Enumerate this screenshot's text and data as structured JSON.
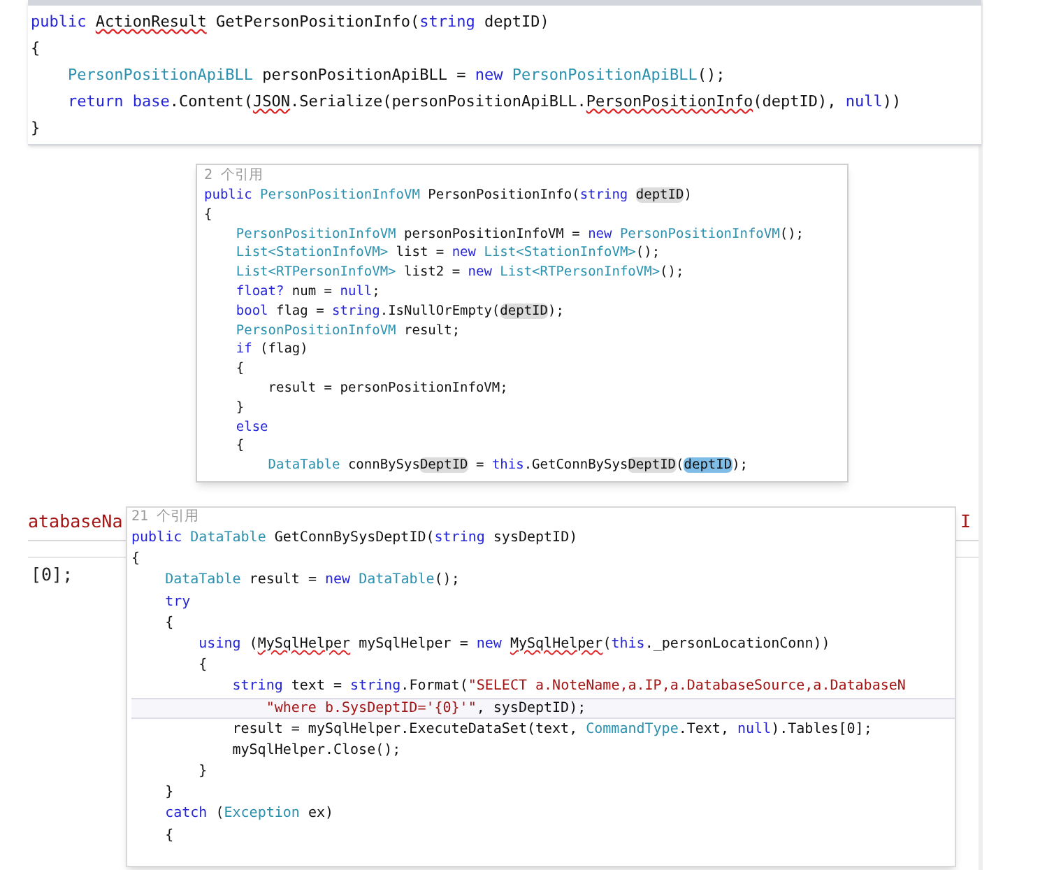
{
  "background": {
    "left_text": "atabaseNa",
    "right_text": "I",
    "second_line": "[0];"
  },
  "panels": [
    {
      "lines": [
        {
          "kind": "code",
          "tokens": [
            {
              "kind": "keyword",
              "text": "public "
            },
            {
              "kind": "error",
              "text": "ActionResult"
            },
            {
              "kind": "plain",
              "text": " GetPersonPositionInfo("
            },
            {
              "kind": "keyword",
              "text": "string"
            },
            {
              "kind": "plain",
              "text": " deptID)"
            }
          ]
        },
        {
          "kind": "code",
          "tokens": [
            {
              "kind": "plain",
              "text": "{"
            }
          ]
        },
        {
          "kind": "code",
          "tokens": [
            {
              "kind": "type",
              "text": "    PersonPositionApiBLL"
            },
            {
              "kind": "plain",
              "text": " personPositionApiBLL = "
            },
            {
              "kind": "keyword",
              "text": "new "
            },
            {
              "kind": "type",
              "text": "PersonPositionApiBLL"
            },
            {
              "kind": "plain",
              "text": "();"
            }
          ]
        },
        {
          "kind": "code",
          "tokens": [
            {
              "kind": "keyword",
              "text": "    return base"
            },
            {
              "kind": "plain",
              "text": ".Content("
            },
            {
              "kind": "error",
              "text": "JSON"
            },
            {
              "kind": "plain",
              "text": ".Serialize(personPositionApiBLL."
            },
            {
              "kind": "error",
              "text": "PersonPositionInfo"
            },
            {
              "kind": "plain",
              "text": "(deptID), "
            },
            {
              "kind": "keyword",
              "text": "null"
            },
            {
              "kind": "plain",
              "text": "))"
            }
          ]
        },
        {
          "kind": "code",
          "tokens": [
            {
              "kind": "plain",
              "text": "}"
            }
          ]
        }
      ]
    },
    {
      "lines": [
        {
          "kind": "lens",
          "text": "2 个引用"
        },
        {
          "kind": "code",
          "tokens": [
            {
              "kind": "keyword",
              "text": "public "
            },
            {
              "kind": "type",
              "text": "PersonPositionInfoVM"
            },
            {
              "kind": "plain",
              "text": " PersonPositionInfo("
            },
            {
              "kind": "keyword",
              "text": "string "
            },
            {
              "kind": "highlight",
              "text": "deptID"
            },
            {
              "kind": "plain",
              "text": ")"
            }
          ]
        },
        {
          "kind": "code",
          "tokens": [
            {
              "kind": "plain",
              "text": "{"
            }
          ]
        },
        {
          "kind": "code",
          "tokens": [
            {
              "kind": "type",
              "text": "    PersonPositionInfoVM"
            },
            {
              "kind": "plain",
              "text": " personPositionInfoVM = "
            },
            {
              "kind": "keyword",
              "text": "new "
            },
            {
              "kind": "type",
              "text": "PersonPositionInfoVM"
            },
            {
              "kind": "plain",
              "text": "();"
            }
          ]
        },
        {
          "kind": "code",
          "tokens": [
            {
              "kind": "type",
              "text": "    List<StationInfoVM>"
            },
            {
              "kind": "plain",
              "text": " list = "
            },
            {
              "kind": "keyword",
              "text": "new "
            },
            {
              "kind": "type",
              "text": "List<StationInfoVM>"
            },
            {
              "kind": "plain",
              "text": "();"
            }
          ]
        },
        {
          "kind": "code",
          "tokens": [
            {
              "kind": "type",
              "text": "    List<RTPersonInfoVM>"
            },
            {
              "kind": "plain",
              "text": " list2 = "
            },
            {
              "kind": "keyword",
              "text": "new "
            },
            {
              "kind": "type",
              "text": "List<RTPersonInfoVM>"
            },
            {
              "kind": "plain",
              "text": "();"
            }
          ]
        },
        {
          "kind": "code",
          "tokens": [
            {
              "kind": "keyword",
              "text": "    float?"
            },
            {
              "kind": "plain",
              "text": " num = "
            },
            {
              "kind": "keyword",
              "text": "null"
            },
            {
              "kind": "plain",
              "text": ";"
            }
          ]
        },
        {
          "kind": "code",
          "tokens": [
            {
              "kind": "keyword",
              "text": "    bool"
            },
            {
              "kind": "plain",
              "text": " flag = "
            },
            {
              "kind": "keyword",
              "text": "string"
            },
            {
              "kind": "plain",
              "text": ".IsNullOrEmpty("
            },
            {
              "kind": "highlight",
              "text": "deptID"
            },
            {
              "kind": "plain",
              "text": ");"
            }
          ]
        },
        {
          "kind": "code",
          "tokens": [
            {
              "kind": "type",
              "text": "    PersonPositionInfoVM"
            },
            {
              "kind": "plain",
              "text": " result;"
            }
          ]
        },
        {
          "kind": "code",
          "tokens": [
            {
              "kind": "keyword",
              "text": "    if"
            },
            {
              "kind": "plain",
              "text": " (flag)"
            }
          ]
        },
        {
          "kind": "code",
          "tokens": [
            {
              "kind": "plain",
              "text": "    {"
            }
          ]
        },
        {
          "kind": "code",
          "tokens": [
            {
              "kind": "plain",
              "text": "        result = personPositionInfoVM;"
            }
          ]
        },
        {
          "kind": "code",
          "tokens": [
            {
              "kind": "plain",
              "text": "    }"
            }
          ]
        },
        {
          "kind": "code",
          "tokens": [
            {
              "kind": "keyword",
              "text": "    else"
            }
          ]
        },
        {
          "kind": "code",
          "tokens": [
            {
              "kind": "plain",
              "text": "    {"
            }
          ]
        },
        {
          "kind": "code",
          "tokens": [
            {
              "kind": "type",
              "text": "        DataTable"
            },
            {
              "kind": "plain",
              "text": " connBySys"
            },
            {
              "kind": "highlight",
              "text": "DeptID"
            },
            {
              "kind": "plain",
              "text": " = "
            },
            {
              "kind": "keyword",
              "text": "this"
            },
            {
              "kind": "plain",
              "text": ".GetConnBySys"
            },
            {
              "kind": "highlight",
              "text": "DeptID"
            },
            {
              "kind": "plain",
              "text": "("
            },
            {
              "kind": "highlight_selected",
              "text": "deptID"
            },
            {
              "kind": "plain",
              "text": ");"
            }
          ]
        }
      ]
    },
    {
      "lines": [
        {
          "kind": "lens",
          "text": "21 个引用",
          "current": false
        },
        {
          "kind": "code",
          "current": false,
          "tokens": [
            {
              "kind": "keyword",
              "text": "public "
            },
            {
              "kind": "type",
              "text": "DataTable"
            },
            {
              "kind": "plain",
              "text": " GetConnBySysDeptID("
            },
            {
              "kind": "keyword",
              "text": "string"
            },
            {
              "kind": "plain",
              "text": " sysDeptID)"
            }
          ]
        },
        {
          "kind": "code",
          "current": false,
          "tokens": [
            {
              "kind": "plain",
              "text": "{"
            }
          ]
        },
        {
          "kind": "code",
          "current": false,
          "tokens": [
            {
              "kind": "type",
              "text": "    DataTable"
            },
            {
              "kind": "plain",
              "text": " result = "
            },
            {
              "kind": "keyword",
              "text": "new "
            },
            {
              "kind": "type",
              "text": "DataTable"
            },
            {
              "kind": "plain",
              "text": "();"
            }
          ]
        },
        {
          "kind": "code",
          "current": false,
          "tokens": [
            {
              "kind": "keyword",
              "text": "    try"
            }
          ]
        },
        {
          "kind": "code",
          "current": false,
          "tokens": [
            {
              "kind": "plain",
              "text": "    {"
            }
          ]
        },
        {
          "kind": "code",
          "current": false,
          "tokens": [
            {
              "kind": "keyword",
              "text": "        using"
            },
            {
              "kind": "plain",
              "text": " ("
            },
            {
              "kind": "error",
              "text": "MySqlHelper"
            },
            {
              "kind": "plain",
              "text": " mySqlHelper = "
            },
            {
              "kind": "keyword",
              "text": "new "
            },
            {
              "kind": "error",
              "text": "MySqlHelper"
            },
            {
              "kind": "plain",
              "text": "("
            },
            {
              "kind": "keyword",
              "text": "this"
            },
            {
              "kind": "plain",
              "text": "._personLocationConn))"
            }
          ]
        },
        {
          "kind": "code",
          "current": false,
          "tokens": [
            {
              "kind": "plain",
              "text": "        {"
            }
          ]
        },
        {
          "kind": "code",
          "current": false,
          "tokens": [
            {
              "kind": "keyword",
              "text": "            string"
            },
            {
              "kind": "plain",
              "text": " text = "
            },
            {
              "kind": "keyword",
              "text": "string"
            },
            {
              "kind": "plain",
              "text": ".Format("
            },
            {
              "kind": "string",
              "text": "\"SELECT a.NoteName,a.IP,a.DatabaseSource,a.DatabaseN"
            }
          ]
        },
        {
          "kind": "code",
          "current": true,
          "tokens": [
            {
              "kind": "string",
              "text": "                \"where b.SysDeptID='{0}'\""
            },
            {
              "kind": "plain",
              "text": ", sysDeptID);"
            }
          ]
        },
        {
          "kind": "code",
          "current": false,
          "tokens": [
            {
              "kind": "plain",
              "text": "            result = mySqlHelper.ExecuteDataSet(text, "
            },
            {
              "kind": "type",
              "text": "CommandType"
            },
            {
              "kind": "plain",
              "text": ".Text, "
            },
            {
              "kind": "keyword",
              "text": "null"
            },
            {
              "kind": "plain",
              "text": ").Tables[0];"
            }
          ]
        },
        {
          "kind": "code",
          "current": false,
          "tokens": [
            {
              "kind": "plain",
              "text": "            mySqlHelper.Close();"
            }
          ]
        },
        {
          "kind": "code",
          "current": false,
          "tokens": [
            {
              "kind": "plain",
              "text": "        }"
            }
          ]
        },
        {
          "kind": "code",
          "current": false,
          "tokens": [
            {
              "kind": "plain",
              "text": "    }"
            }
          ]
        },
        {
          "kind": "code",
          "current": false,
          "tokens": [
            {
              "kind": "keyword",
              "text": "    catch"
            },
            {
              "kind": "plain",
              "text": " ("
            },
            {
              "kind": "type",
              "text": "Exception"
            },
            {
              "kind": "plain",
              "text": " ex)"
            }
          ]
        },
        {
          "kind": "code",
          "current": false,
          "tokens": [
            {
              "kind": "plain",
              "text": "    {"
            }
          ]
        }
      ]
    }
  ]
}
